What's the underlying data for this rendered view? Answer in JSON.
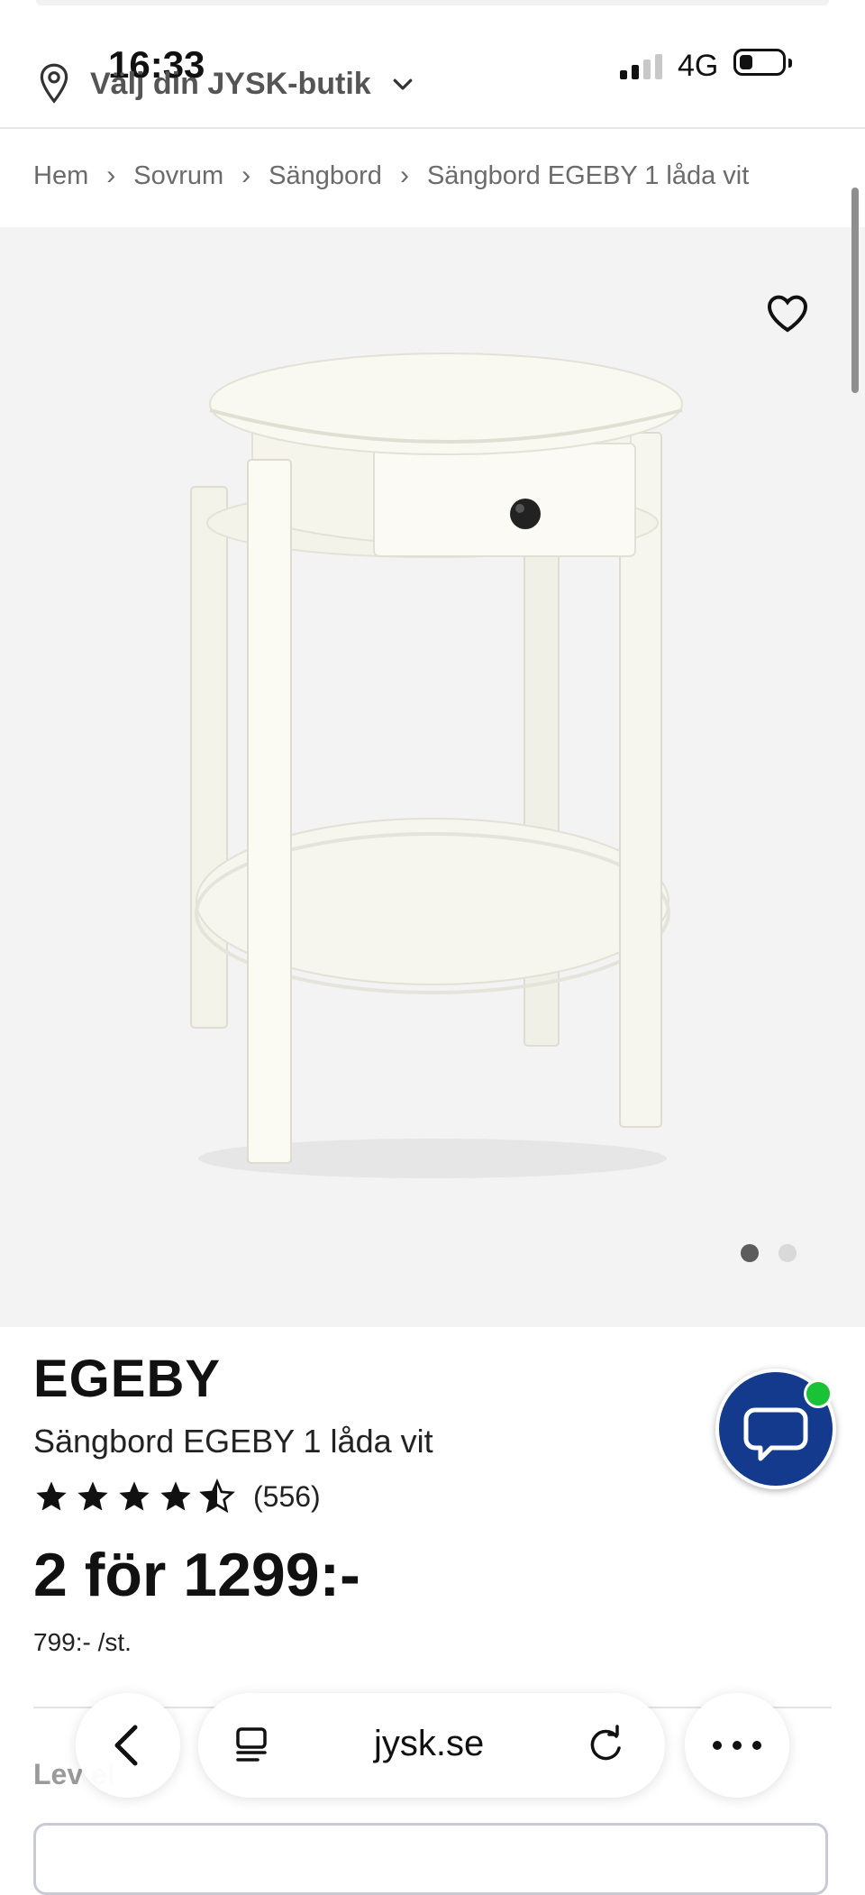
{
  "status_bar": {
    "time": "16:33",
    "network": "4G",
    "signal_bars_active": 2,
    "signal_bars_total": 4,
    "battery_level": 0.25
  },
  "header": {
    "store_selector_label": "Välj din JYSK-butik",
    "location_icon": "location-pin-icon",
    "chevron_icon": "chevron-down-icon"
  },
  "breadcrumb": {
    "items": [
      "Hem",
      "Sovrum",
      "Sängbord",
      "Sängbord EGEBY 1 låda vit"
    ],
    "separator": "›"
  },
  "gallery": {
    "favorite_icon": "heart-outline-icon",
    "image_count": 2,
    "active_index": 0,
    "background": "#f3f3f3"
  },
  "product": {
    "brand": "EGEBY",
    "name": "Sängbord EGEBY 1 låda vit",
    "rating": 4.5,
    "rating_max": 5,
    "review_count": "(556)",
    "price": "2 för 1299:-",
    "unit_price": "799:- /st."
  },
  "delivery": {
    "label": "Lev      el"
  },
  "chat": {
    "icon": "chat-bubble-icon",
    "online_color": "#19c236",
    "color": "#133a8c"
  },
  "browser": {
    "url": "jysk.se",
    "back_icon": "back-chevron-icon",
    "tabs_icon": "tabs-icon",
    "reload_icon": "reload-icon",
    "more_icon": "more-dots-icon"
  }
}
